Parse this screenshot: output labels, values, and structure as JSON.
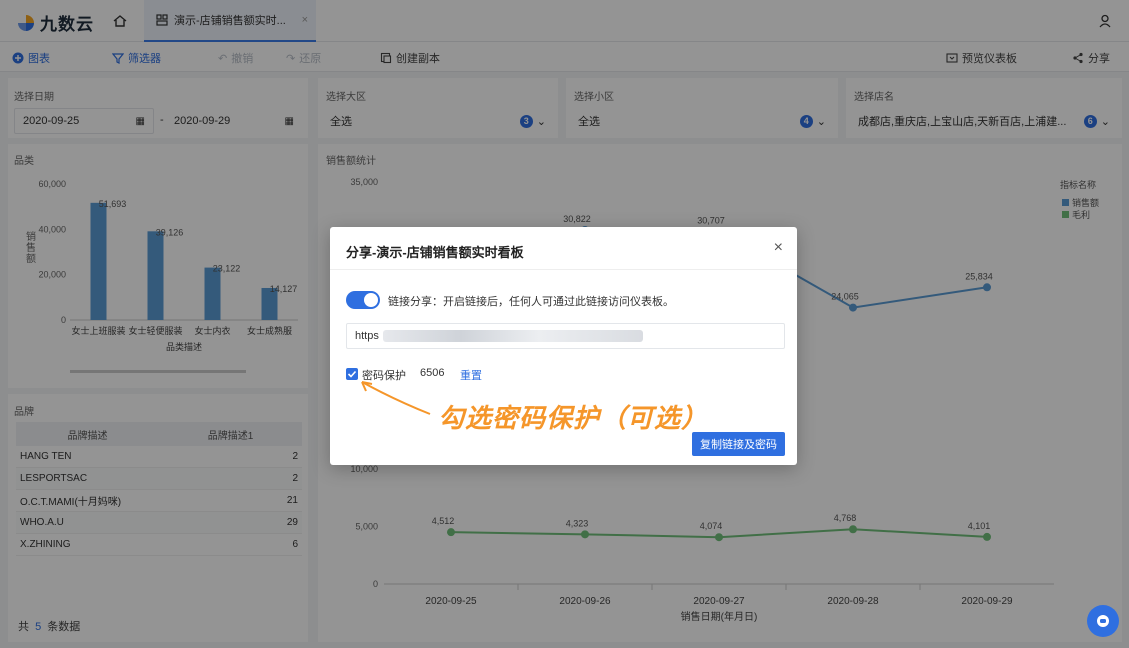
{
  "header": {
    "logo_text": "九数云",
    "tab_label": "演示-店铺销售额实时...",
    "tab_close": "×"
  },
  "toolbar": {
    "chart": "图表",
    "filter": "筛选器",
    "undo": "撤销",
    "redo": "还原",
    "copy": "创建副本",
    "preview": "预览仪表板",
    "share": "分享"
  },
  "filters": {
    "date": {
      "label": "选择日期",
      "start": "2020-09-25",
      "sep": "-",
      "end": "2020-09-29"
    },
    "region": {
      "label": "选择大区",
      "value": "全选",
      "count": "3"
    },
    "subregion": {
      "label": "选择小区",
      "value": "全选",
      "count": "4"
    },
    "store": {
      "label": "选择店名",
      "value": "成都店,重庆店,上宝山店,天新百店,上浦建...",
      "count": "6"
    }
  },
  "category_panel": {
    "title": "品类"
  },
  "brand_panel": {
    "title": "品牌",
    "columns": [
      "品牌描述",
      "品牌描述1"
    ],
    "rows": [
      {
        "name": "HANG TEN",
        "value": "2"
      },
      {
        "name": "LESPORTSAC",
        "value": "2"
      },
      {
        "name": "O.C.T.MAMI(十月妈咪)",
        "value": "21"
      },
      {
        "name": "WHO.A.U",
        "value": "29"
      },
      {
        "name": "X.ZHINING",
        "value": "6"
      }
    ],
    "footer_prefix": "共",
    "footer_count": "5",
    "footer_suffix": "条数据"
  },
  "sales_panel": {
    "title": "销售额统计"
  },
  "chart_data": [
    {
      "type": "bar",
      "ylabel": "销售额",
      "xlabel": "品类描述",
      "categories": [
        "女士上班服装",
        "女士轻便服装",
        "女士内衣",
        "女士成熟服"
      ],
      "values": [
        51693,
        39126,
        23122,
        14127
      ],
      "value_labels": [
        "51,693",
        "39,126",
        "23,122",
        "14,127"
      ],
      "ylim": [
        0,
        60000
      ],
      "yticks": [
        "60,000",
        "40,000",
        "20,000",
        "0"
      ],
      "colors": {
        "bar": "#5b9bd5"
      }
    },
    {
      "type": "line",
      "xlabel": "销售日期(年月日)",
      "x": [
        "2020-09-25",
        "2020-09-26",
        "2020-09-27",
        "2020-09-28",
        "2020-09-29"
      ],
      "legend_title": "指标名称",
      "ylim": [
        0,
        35000
      ],
      "yticks": [
        "35,000",
        "10,000",
        "5,000",
        "0"
      ],
      "series": [
        {
          "name": "销售额",
          "values": [
            null,
            30822,
            30707,
            24065,
            25834
          ],
          "labels": [
            "",
            "30,822",
            "30,707",
            "24,065",
            "25,834"
          ],
          "color": "#5b9bd5"
        },
        {
          "name": "毛利",
          "values": [
            4512,
            4323,
            4074,
            4768,
            4101
          ],
          "labels": [
            "4,512",
            "4,323",
            "4,074",
            "4,768",
            "4,101"
          ],
          "color": "#70c07a"
        }
      ]
    }
  ],
  "modal": {
    "title": "分享-演示-店铺销售额实时看板",
    "close": "×",
    "toggle_label": "链接分享：开启链接后，任何人可通过此链接访问仪表板。",
    "url_prefix": "https",
    "password_label": "密码保护",
    "password_value": "6506",
    "reset": "重置",
    "copy_button": "复制链接及密码"
  },
  "annotation": "勾选密码保护（可选）"
}
